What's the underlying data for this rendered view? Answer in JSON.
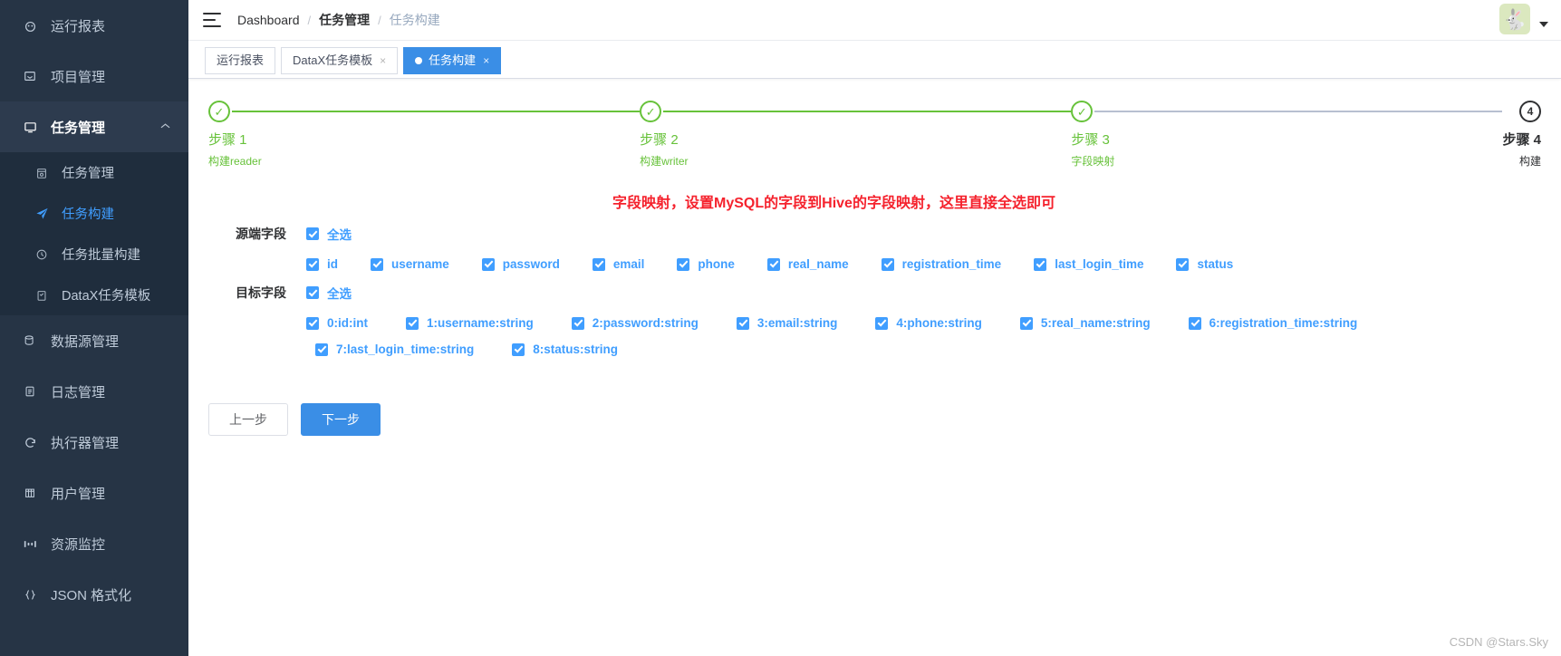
{
  "sidebar": {
    "items": [
      {
        "label": "运行报表",
        "icon": "dashboard-icon",
        "type": "item"
      },
      {
        "label": "项目管理",
        "icon": "project-icon",
        "type": "item"
      },
      {
        "label": "任务管理",
        "icon": "monitor-icon",
        "type": "parent",
        "expanded": true,
        "arrow": "▲"
      }
    ],
    "submenu": [
      {
        "label": "任务管理",
        "icon": "calendar-icon",
        "selected": false
      },
      {
        "label": "任务构建",
        "icon": "send-icon",
        "selected": true
      },
      {
        "label": "任务批量构建",
        "icon": "clock-icon",
        "selected": false
      },
      {
        "label": "DataX任务模板",
        "icon": "clipboard-check-icon",
        "selected": false
      }
    ],
    "items_after": [
      {
        "label": "数据源管理",
        "icon": "database-icon"
      },
      {
        "label": "日志管理",
        "icon": "document-icon"
      },
      {
        "label": "执行器管理",
        "icon": "refresh-icon"
      },
      {
        "label": "用户管理",
        "icon": "grid-icon"
      },
      {
        "label": "资源监控",
        "icon": "monitor-data-icon"
      },
      {
        "label": "JSON 格式化",
        "icon": "braces-icon"
      }
    ]
  },
  "header": {
    "menu_icon": "hamburger-icon",
    "breadcrumb": [
      {
        "label": "Dashboard",
        "current": false,
        "bold": false
      },
      {
        "label": "任务管理",
        "current": false,
        "bold": true
      },
      {
        "label": "任务构建",
        "current": true,
        "bold": false
      }
    ],
    "separator": "/",
    "avatar_icon": "rabbit-avatar",
    "avatar_glyph": "🐇",
    "caret_icon": "chevron-down-icon"
  },
  "tabs": [
    {
      "label": "运行报表",
      "active": false,
      "closable": false
    },
    {
      "label": "DataX任务模板",
      "active": false,
      "closable": true,
      "close": "×"
    },
    {
      "label": "任务构建",
      "active": true,
      "closable": true,
      "close": "×"
    }
  ],
  "steps": [
    {
      "title": "步骤 1",
      "desc": "构建reader",
      "state": "done",
      "mark": "✓"
    },
    {
      "title": "步骤 2",
      "desc": "构建writer",
      "state": "done",
      "mark": "✓"
    },
    {
      "title": "步骤 3",
      "desc": "字段映射",
      "state": "done",
      "mark": "✓"
    },
    {
      "title": "步骤 4",
      "desc": "构建",
      "state": "pending",
      "mark": "4"
    }
  ],
  "note": "字段映射，设置MySQL的字段到Hive的字段映射，这里直接全选即可",
  "source_section": {
    "label": "源端字段",
    "select_all": "全选",
    "fields": [
      "id",
      "username",
      "password",
      "email",
      "phone",
      "real_name",
      "registration_time",
      "last_login_time",
      "status"
    ]
  },
  "target_section": {
    "label": "目标字段",
    "select_all": "全选",
    "fields_row1": [
      "0:id:int",
      "1:username:string",
      "2:password:string",
      "3:email:string",
      "4:phone:string",
      "5:real_name:string",
      "6:registration_time:string"
    ],
    "fields_row2": [
      "7:last_login_time:string",
      "8:status:string"
    ]
  },
  "buttons": {
    "prev": "上一步",
    "next": "下一步"
  },
  "watermark": "CSDN @Stars.Sky",
  "colors": {
    "sidebar_bg": "#263445",
    "submenu_bg": "#1f2d3d",
    "accent_blue": "#409EFF",
    "tab_active": "#3a8ee6",
    "step_done": "#67C23A",
    "note_red": "#f5222d"
  }
}
